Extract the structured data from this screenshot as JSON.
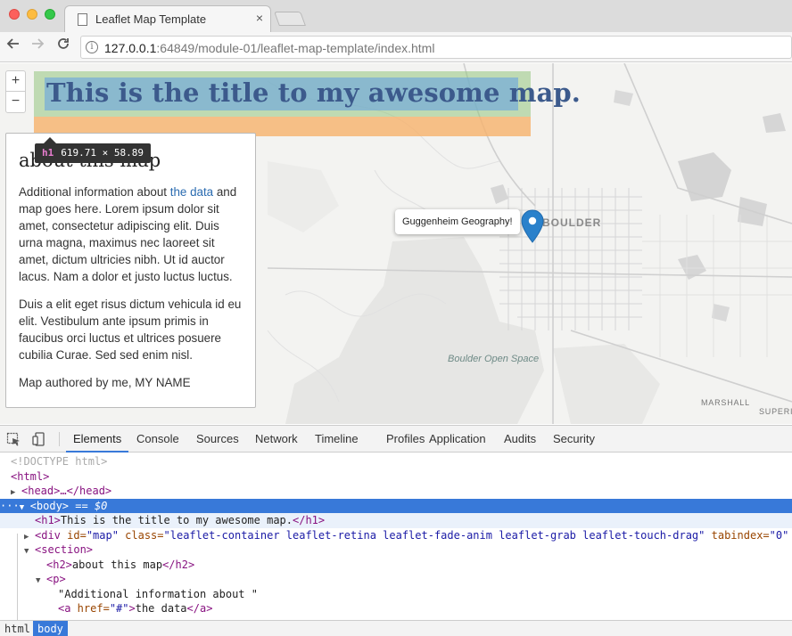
{
  "browser": {
    "tab_title": "Leaflet Map Template",
    "tab_close": "×",
    "url_host": "127.0.0.1",
    "url_path": ":64849/module-01/leaflet-map-template/index.html",
    "info_glyph": "i"
  },
  "map": {
    "zoom_in": "+",
    "zoom_out": "−",
    "title": "This is the title to my awesome map.",
    "popup_text": "Guggenheim Geography!",
    "label_boulder": "BOULDER",
    "label_open_space": "Boulder Open Space",
    "label_marshall": "MARSHALL",
    "label_superior": "SUPERIOR",
    "marker_color": "#2a81cb"
  },
  "inspect_tooltip": {
    "tag": "h1",
    "dims": "619.71 × 58.89"
  },
  "panel": {
    "heading": "about this map",
    "p1_before": "Additional information about ",
    "p1_link": "the data",
    "p1_after": " and map goes here. Lorem ipsum dolor sit amet, consectetur adipiscing elit. Duis urna magna, maximus nec laoreet sit amet, dictum ultricies nibh. Ut id auctor lacus. Nam a dolor et justo luctus luctus.",
    "p2": "Duis a elit eget risus dictum vehicula id eu elit. Vestibulum ante ipsum primis in faucibus orci luctus et ultrices posuere cubilia Curae. Sed sed enim nisl.",
    "p3": "Map authored by me, MY NAME"
  },
  "devtools": {
    "tabs": [
      "Elements",
      "Console",
      "Sources",
      "Network",
      "Timeline",
      "Profiles",
      "Application",
      "Audits",
      "Security"
    ],
    "active_tab": "Elements",
    "dom": {
      "doctype": "<!DOCTYPE html>",
      "html_open": "<html>",
      "head": "<head>…</head>",
      "body_open": "<body>",
      "body_marker": " == $0",
      "h1_tag_open": "<h1>",
      "h1_text": "This is the title to my awesome map.",
      "h1_tag_close": "</h1>",
      "div_open": "<div",
      "div_id_attr": " id=",
      "div_id_val": "\"map\"",
      "div_class_attr": " class=",
      "div_class_val": "\"leaflet-container leaflet-retina leaflet-fade-anim leaflet-grab leaflet-touch-drag\"",
      "div_tabindex_attr": " tabindex=",
      "div_tabindex_val": "\"0\"",
      "section_open": "<section>",
      "h2_open": "<h2>",
      "h2_text": "about this map",
      "h2_close": "</h2>",
      "p_open": "<p>",
      "text_node": "\"Additional information about \"",
      "a_open": "<a",
      "a_href_attr": " href=",
      "a_href_val": "\"#\"",
      "a_gt": ">",
      "a_text": "the data",
      "a_close": "</a>"
    },
    "breadcrumbs": [
      "html",
      "body"
    ],
    "active_crumb": "body"
  }
}
